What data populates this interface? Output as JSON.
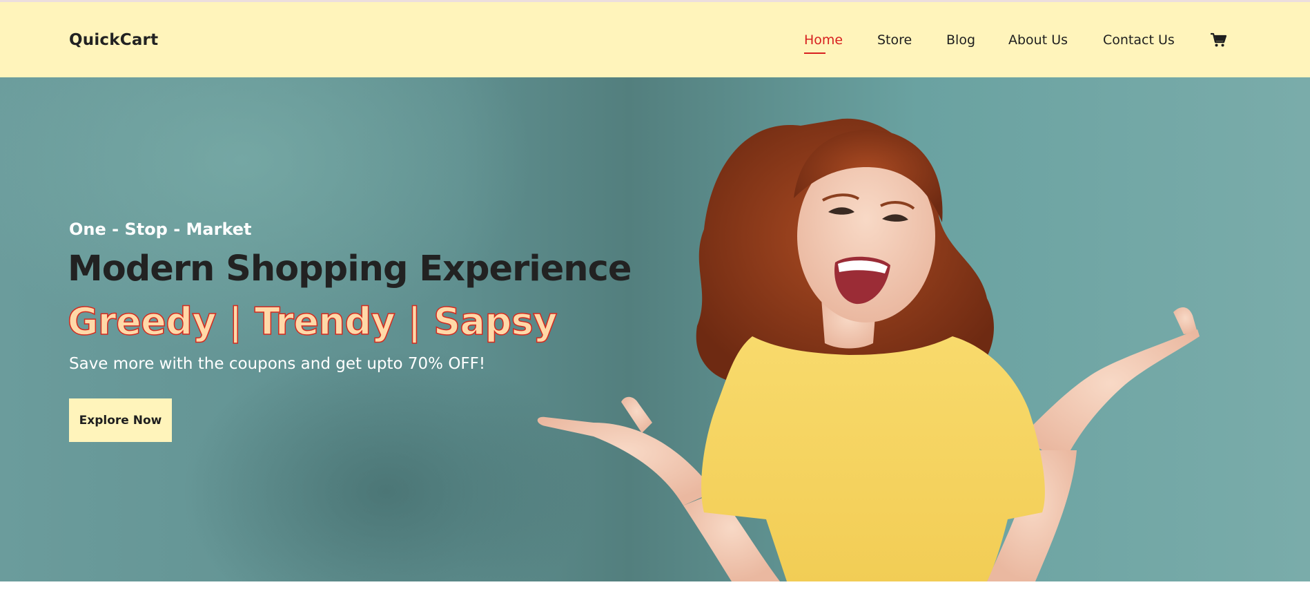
{
  "header": {
    "brand": "QuickCart",
    "nav": [
      {
        "label": "Home",
        "active": true
      },
      {
        "label": "Store"
      },
      {
        "label": "Blog"
      },
      {
        "label": "About Us"
      },
      {
        "label": "Contact Us"
      }
    ],
    "cart_icon": "shopping-cart-icon"
  },
  "hero": {
    "tagline": "One - Stop - Market",
    "headline": "Modern Shopping Experience",
    "headline_outline": "Greedy | Trendy | Sapsy",
    "subtext": "Save more with the coupons and get upto 70% OFF!",
    "cta_label": "Explore Now"
  },
  "colors": {
    "nav_background": "#fff4bb",
    "active_link": "#d71f1f",
    "hero_background": "#6b9c9c",
    "outline_text_stroke": "#d42a1f",
    "shirt": "#f6d365"
  }
}
